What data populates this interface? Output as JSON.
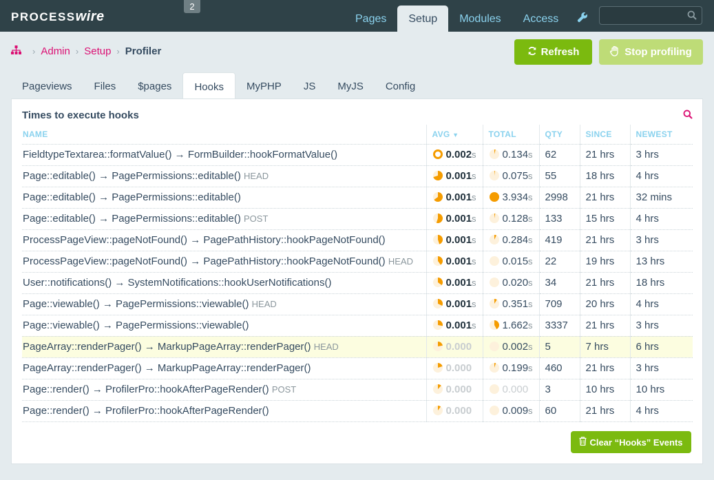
{
  "masthead": {
    "logo_main": "PROCESS",
    "logo_wire": "wire",
    "notice_count": "2",
    "nav": [
      {
        "label": "Pages",
        "active": false
      },
      {
        "label": "Setup",
        "active": true
      },
      {
        "label": "Modules",
        "active": false
      },
      {
        "label": "Access",
        "active": false
      }
    ],
    "search_placeholder": ""
  },
  "breadcrumbs": {
    "items": [
      "Admin",
      "Setup"
    ],
    "current": "Profiler"
  },
  "actions": {
    "refresh_label": "Refresh",
    "stop_label": "Stop profiling"
  },
  "tabs": [
    "Pageviews",
    "Files",
    "$pages",
    "Hooks",
    "MyPHP",
    "JS",
    "MyJS",
    "Config"
  ],
  "active_tab": "Hooks",
  "panel": {
    "title": "Times to execute hooks",
    "columns": [
      "NAME",
      "AVG",
      "TOTAL",
      "QTY",
      "SINCE",
      "NEWEST"
    ],
    "sort_column": "AVG",
    "rows": [
      {
        "name": "FieldtypeTextarea::formatValue() → FormBuilder::hookFormatValue()",
        "tag": "",
        "avg": "0.002",
        "avg_unit": "s",
        "avg_frac": 1.0,
        "avg_ring": true,
        "total": "0.134",
        "total_unit": "s",
        "total_frac": 0.04,
        "qty": "62",
        "since": "21 hrs",
        "newest": "3 hrs",
        "highlight": false
      },
      {
        "name": "Page::editable() → PagePermissions::editable()",
        "tag": "HEAD",
        "avg": "0.001",
        "avg_unit": "s",
        "avg_frac": 0.7,
        "avg_ring": false,
        "total": "0.075",
        "total_unit": "s",
        "total_frac": 0.02,
        "qty": "55",
        "since": "18 hrs",
        "newest": "4 hrs",
        "highlight": false
      },
      {
        "name": "Page::editable() → PagePermissions::editable()",
        "tag": "",
        "avg": "0.001",
        "avg_unit": "s",
        "avg_frac": 0.65,
        "avg_ring": false,
        "total": "3.934",
        "total_unit": "s",
        "total_frac": 1.0,
        "qty": "2998",
        "since": "21 hrs",
        "newest": "32 mins",
        "highlight": false
      },
      {
        "name": "Page::editable() → PagePermissions::editable()",
        "tag": "POST",
        "avg": "0.001",
        "avg_unit": "s",
        "avg_frac": 0.55,
        "avg_ring": false,
        "total": "0.128",
        "total_unit": "s",
        "total_frac": 0.03,
        "qty": "133",
        "since": "15 hrs",
        "newest": "4 hrs",
        "highlight": false
      },
      {
        "name": "ProcessPageView::pageNotFound() → PagePathHistory::hookPageNotFound()",
        "tag": "",
        "avg": "0.001",
        "avg_unit": "s",
        "avg_frac": 0.45,
        "avg_ring": false,
        "total": "0.284",
        "total_unit": "s",
        "total_frac": 0.07,
        "qty": "419",
        "since": "21 hrs",
        "newest": "3 hrs",
        "highlight": false
      },
      {
        "name": "ProcessPageView::pageNotFound() → PagePathHistory::hookPageNotFound()",
        "tag": "HEAD",
        "avg": "0.001",
        "avg_unit": "s",
        "avg_frac": 0.4,
        "avg_ring": false,
        "total": "0.015",
        "total_unit": "s",
        "total_frac": 0.0,
        "qty": "22",
        "since": "19 hrs",
        "newest": "13 hrs",
        "highlight": false
      },
      {
        "name": "User::notifications() → SystemNotifications::hookUserNotifications()",
        "tag": "",
        "avg": "0.001",
        "avg_unit": "s",
        "avg_frac": 0.35,
        "avg_ring": false,
        "total": "0.020",
        "total_unit": "s",
        "total_frac": 0.0,
        "qty": "34",
        "since": "21 hrs",
        "newest": "18 hrs",
        "highlight": false
      },
      {
        "name": "Page::viewable() → PagePermissions::viewable()",
        "tag": "HEAD",
        "avg": "0.001",
        "avg_unit": "s",
        "avg_frac": 0.32,
        "avg_ring": false,
        "total": "0.351",
        "total_unit": "s",
        "total_frac": 0.09,
        "qty": "709",
        "since": "20 hrs",
        "newest": "4 hrs",
        "highlight": false
      },
      {
        "name": "Page::viewable() → PagePermissions::viewable()",
        "tag": "",
        "avg": "0.001",
        "avg_unit": "s",
        "avg_frac": 0.28,
        "avg_ring": false,
        "total": "1.662",
        "total_unit": "s",
        "total_frac": 0.42,
        "qty": "3337",
        "since": "21 hrs",
        "newest": "3 hrs",
        "highlight": false
      },
      {
        "name": "PageArray::renderPager() → MarkupPageArray::renderPager()",
        "tag": "HEAD",
        "avg": "0.000",
        "avg_unit": "",
        "avg_frac": 0.22,
        "avg_ring": false,
        "total": "0.002",
        "total_unit": "s",
        "total_frac": 0.0,
        "qty": "5",
        "since": "7 hrs",
        "newest": "6 hrs",
        "highlight": true
      },
      {
        "name": "PageArray::renderPager() → MarkupPageArray::renderPager()",
        "tag": "",
        "avg": "0.000",
        "avg_unit": "",
        "avg_frac": 0.2,
        "avg_ring": false,
        "total": "0.199",
        "total_unit": "s",
        "total_frac": 0.05,
        "qty": "460",
        "since": "21 hrs",
        "newest": "3 hrs",
        "highlight": false
      },
      {
        "name": "Page::render() → ProfilerPro::hookAfterPageRender()",
        "tag": "POST",
        "avg": "0.000",
        "avg_unit": "",
        "avg_frac": 0.12,
        "avg_ring": false,
        "total": "0.000",
        "total_unit": "",
        "total_frac": 0.0,
        "qty": "3",
        "since": "10 hrs",
        "newest": "10 hrs",
        "highlight": false
      },
      {
        "name": "Page::render() → ProfilerPro::hookAfterPageRender()",
        "tag": "",
        "avg": "0.000",
        "avg_unit": "",
        "avg_frac": 0.1,
        "avg_ring": false,
        "total": "0.009",
        "total_unit": "s",
        "total_frac": 0.0,
        "qty": "60",
        "since": "21 hrs",
        "newest": "4 hrs",
        "highlight": false
      }
    ],
    "clear_label": "Clear “Hooks” Events"
  },
  "colors": {
    "accent": "#db1174",
    "pie_fill": "#f59c00",
    "pie_bg": "#fdf1dc",
    "button_green": "#7bba0f",
    "masthead": "#2f4248"
  },
  "icons": {
    "home": "sitemap-icon",
    "refresh": "refresh-icon",
    "stop": "hand-stop-icon",
    "wrench": "wrench-icon",
    "search": "search-icon",
    "trash": "trash-icon",
    "sort": "caret-down-icon"
  }
}
